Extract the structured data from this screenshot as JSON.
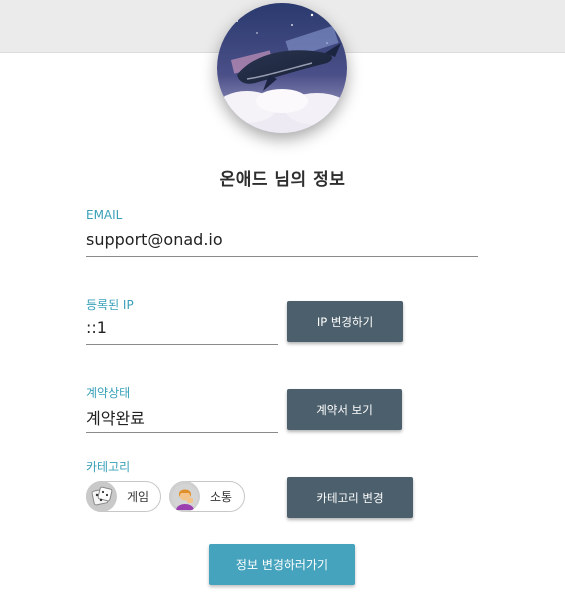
{
  "profile": {
    "title": "온애드 님의 정보",
    "avatar_icon": "whale-avatar-image"
  },
  "email": {
    "label": "EMAIL",
    "value": "support@onad.io"
  },
  "ip": {
    "label": "등록된 IP",
    "value": "::1",
    "button_label": "IP 변경하기"
  },
  "contract": {
    "label": "계약상태",
    "value": "계약완료",
    "button_label": "계약서 보기"
  },
  "category": {
    "label": "카테고리",
    "chips": [
      {
        "label": "게임",
        "icon": "dice-icon"
      },
      {
        "label": "소통",
        "icon": "person-talking-icon"
      }
    ],
    "button_label": "카테고리 변경"
  },
  "submit_label": "정보 변경하러가기",
  "colors": {
    "accent": "#45a3bd",
    "label": "#3aa0b8",
    "button_dark": "#4c5f6c",
    "header_band": "#ebebeb"
  }
}
